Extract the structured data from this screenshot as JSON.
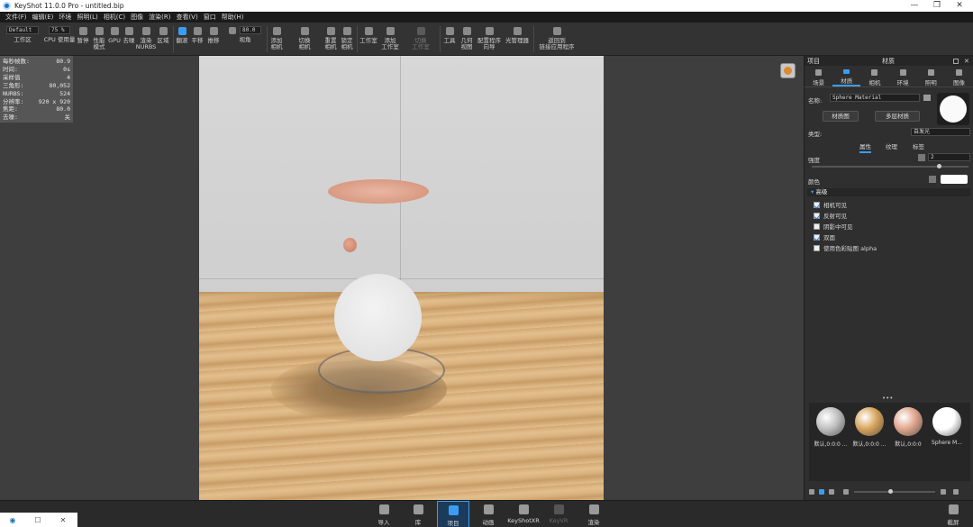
{
  "window": {
    "title": "KeyShot 11.0.0 Pro  -  untitled.bip",
    "minimize": "—",
    "maximize": "❐",
    "close": "✕"
  },
  "menu": [
    "文件(F)",
    "编辑(E)",
    "环境",
    "照明(L)",
    "相机(C)",
    "图像",
    "渲染(R)",
    "查看(V)",
    "窗口",
    "帮助(H)"
  ],
  "toolbar": {
    "workspace_value": "Default",
    "workspace_label": "工作区",
    "cpu_value": "75 %",
    "cpu_label": "CPU 使用量",
    "pause": "暂停",
    "perf_mode": "性能\n模式",
    "gpu": "GPU",
    "denoise": "去噪",
    "nurbs": "渲染\nNURBS",
    "region": "区域",
    "tumble": "翻滚",
    "pan": "平移",
    "dolly": "推移",
    "fov_value": "80.0",
    "fov_label": "视角",
    "add_camera": "添加\n相机",
    "switch_camera": "切换\n相机",
    "reset_camera": "重置\n相机",
    "lock_camera": "锁定\n相机",
    "studio": "工作室",
    "add_studio": "添加\n工作室",
    "switch_studio": "切换\n工作室",
    "tools": "工具",
    "geometry_view": "几何\n视图",
    "configurator": "配置程序\n向导",
    "light_manager": "光管理器",
    "back_link": "返回到\n链接应用程序"
  },
  "stats": [
    {
      "k": "每秒帧数:",
      "v": "80.9"
    },
    {
      "k": "时间:",
      "v": "0s"
    },
    {
      "k": "采样值",
      "v": "4"
    },
    {
      "k": "三角形:",
      "v": "80,052"
    },
    {
      "k": "NURBS:",
      "v": "524"
    },
    {
      "k": "分辨率:",
      "v": "920 x 920"
    },
    {
      "k": "焦距:",
      "v": "80.0"
    },
    {
      "k": "去噪:",
      "v": "关"
    }
  ],
  "panel": {
    "header_left": "项目",
    "header_title": "材质",
    "tabs": [
      "场景",
      "材质",
      "相机",
      "环境",
      "照明",
      "图像"
    ],
    "name_label": "名称:",
    "name_value": "Sphere Material",
    "material_graph": "材质图",
    "multi_material": "多层材质",
    "type_label": "类型:",
    "type_value": "自发光",
    "subtabs": [
      "属性",
      "纹理",
      "标签"
    ],
    "intensity_label": "强度",
    "intensity_value": "2",
    "color_label": "颜色",
    "color_value": "#ffffff",
    "advanced_label": "高级",
    "checks": [
      {
        "label": "相机可见",
        "on": true
      },
      {
        "label": "反射可见",
        "on": true
      },
      {
        "label": "阴影中可见",
        "on": false
      },
      {
        "label": "双面",
        "on": true
      },
      {
        "label": "使用色彩贴图 alpha",
        "on": false
      }
    ],
    "more": "•••",
    "library": [
      {
        "label": "默认,0:0:0 ...",
        "color": "#bfbfbf"
      },
      {
        "label": "默认,0:0:0 ...",
        "color": "#d7a35a"
      },
      {
        "label": "默认,0:0:0",
        "color": "#e0a58c"
      },
      {
        "label": "Sphere M...",
        "color": "#ffffff"
      }
    ]
  },
  "bottom": {
    "import": "导入",
    "library": "库",
    "project": "项目",
    "animation": "动画",
    "keyshotxr": "KeyShotXR",
    "keyvr": "KeyVR",
    "render": "渲染",
    "screenshot": "截屏"
  },
  "colors": {
    "accent": "#3a9df5",
    "panel_bg": "#2f2f2f",
    "toolbar_bg": "#333333"
  }
}
